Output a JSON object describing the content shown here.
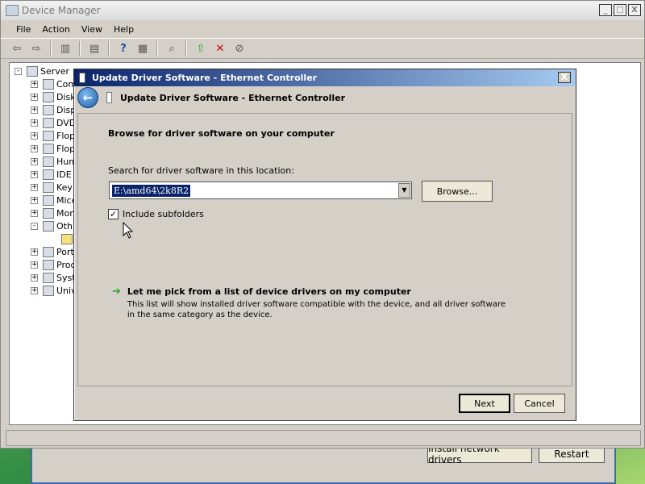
{
  "background_window": {
    "install_button": "Install network drivers",
    "restart_button": "Restart"
  },
  "device_manager": {
    "title": "Device Manager",
    "window_controls": {
      "minimize": "_",
      "maximize": "□",
      "close": "X"
    },
    "menu": [
      "File",
      "Action",
      "View",
      "Help"
    ],
    "toolbar_icons": [
      "back-icon",
      "forward-icon",
      "show-hide-tree-icon",
      "properties-icon",
      "help-icon",
      "action-pane-icon",
      "scan-hardware-icon",
      "update-driver-icon",
      "uninstall-icon",
      "disable-icon"
    ],
    "tree": {
      "root": "Server",
      "items": [
        {
          "label": "Com",
          "expander": "+"
        },
        {
          "label": "Disk",
          "expander": "+"
        },
        {
          "label": "Disp",
          "expander": "+"
        },
        {
          "label": "DVD",
          "expander": "+"
        },
        {
          "label": "Flop",
          "expander": "+"
        },
        {
          "label": "Flop",
          "expander": "+"
        },
        {
          "label": "Hum",
          "expander": "+"
        },
        {
          "label": "IDE",
          "expander": "+"
        },
        {
          "label": "Key",
          "expander": "+"
        },
        {
          "label": "Mice",
          "expander": "+"
        },
        {
          "label": "Mon",
          "expander": "+"
        },
        {
          "label": "Oth",
          "expander": "-"
        },
        {
          "label": "",
          "expander": ""
        },
        {
          "label": "Port",
          "expander": "+"
        },
        {
          "label": "Proc",
          "expander": "+"
        },
        {
          "label": "Syst",
          "expander": "+"
        },
        {
          "label": "Univ",
          "expander": "+"
        }
      ]
    }
  },
  "dialog": {
    "title": "Update Driver Software - Ethernet Controller",
    "header_title": "Update Driver Software - Ethernet Controller",
    "close": "X",
    "heading": "Browse for driver software on your computer",
    "search_label": "Search for driver software in this location:",
    "path_value": "E:\\amd64\\2k8R2",
    "combo_arrow": "▼",
    "browse_button": "Browse...",
    "include_subfolders": {
      "label": "Include subfolders",
      "checked": true,
      "mark": "✓"
    },
    "pick_option": {
      "arrow": "➔",
      "title": "Let me pick from a list of device drivers on my computer",
      "description": "This list will show installed driver software compatible with the device, and all driver software in the same category as the device."
    },
    "next_button": "Next",
    "cancel_button": "Cancel"
  }
}
